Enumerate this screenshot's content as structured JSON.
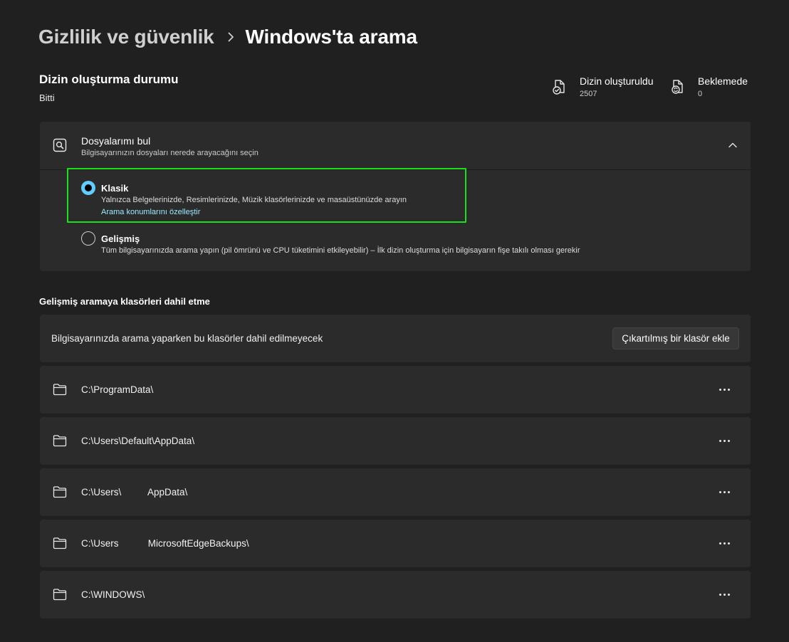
{
  "breadcrumb": {
    "parent": "Gizlilik ve güvenlik",
    "current": "Windows'ta arama"
  },
  "index_status": {
    "title": "Dizin oluşturma durumu",
    "status": "Bitti",
    "indexed_label": "Dizin oluşturuldu",
    "indexed_value": "2507",
    "pending_label": "Beklemede",
    "pending_value": "0"
  },
  "find_files": {
    "title": "Dosyalarımı bul",
    "subtitle": "Bilgisayarınızın dosyaları nerede arayacağını seçin",
    "options": [
      {
        "title": "Klasik",
        "description": "Yalnızca Belgelerinizde, Resimlerinizde, Müzik klasörlerinizde ve masaüstünüzde arayın",
        "link": "Arama konumlarını özelleştir",
        "selected": true
      },
      {
        "title": "Gelişmiş",
        "description": "Tüm bilgisayarınızda arama yapın (pil ömrünü ve CPU tüketimini etkileyebilir) – İlk dizin oluşturma için bilgisayarın fişe takılı olması gerekir",
        "selected": false
      }
    ]
  },
  "exclude": {
    "section_title": "Gelişmiş aramaya klasörleri dahil etme",
    "description": "Bilgisayarınızda arama yaparken bu klasörler dahil edilmeyecek",
    "add_button": "Çıkartılmış bir klasör ekle",
    "folders": [
      "C:\\ProgramData\\",
      "C:\\Users\\Default\\AppData\\",
      "C:\\Users\\          AppData\\",
      "C:\\Users           MicrosoftEdgeBackups\\",
      "C:\\WINDOWS\\"
    ]
  },
  "colors": {
    "background": "#202020",
    "card": "#2b2b2b",
    "accent": "#60cdff",
    "link": "#99ebff",
    "highlight": "#17e21a"
  },
  "icons": {
    "breadcrumb_separator": "chevron-right-icon",
    "indexed": "document-check-icon",
    "pending": "document-sync-icon",
    "find_files": "search-folder-icon",
    "collapse": "chevron-up-icon",
    "folder": "folder-icon",
    "more": "more-icon"
  }
}
